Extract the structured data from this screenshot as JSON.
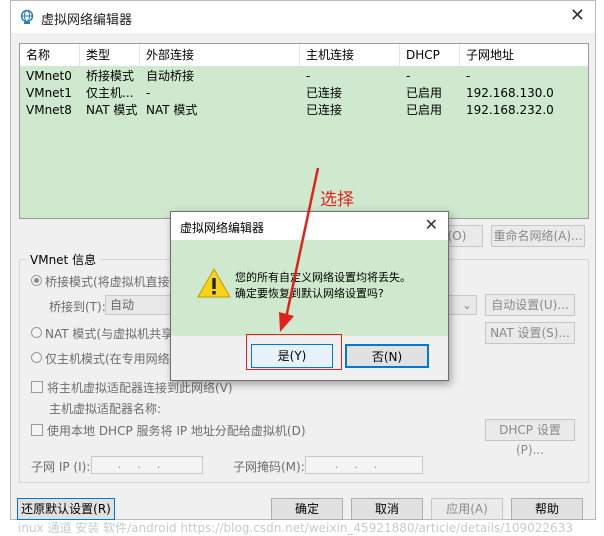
{
  "window": {
    "title": "虚拟网络编辑器",
    "close": "✕"
  },
  "table": {
    "columns": [
      "名称",
      "类型",
      "外部连接",
      "主机连接",
      "DHCP",
      "子网地址"
    ],
    "rows": [
      [
        "VMnet0",
        "桥接模式",
        "自动桥接",
        "-",
        "-",
        "-"
      ],
      [
        "VMnet1",
        "仅主机...",
        "-",
        "已连接",
        "已启用",
        "192.168.130.0"
      ],
      [
        "VMnet8",
        "NAT 模式",
        "NAT 模式",
        "已连接",
        "已启用",
        "192.168.232.0"
      ]
    ]
  },
  "network_buttons": {
    "remove": "(O)",
    "rename": "重命名网络(A)..."
  },
  "vmnet_info": {
    "label": "VMnet 信息",
    "bridged_option": "桥接模式(将虚拟机直接",
    "bridged_to_label": "桥接到(T):",
    "bridged_to_value": "自动",
    "auto_settings": "自动设置(U)...",
    "nat_option": "NAT 模式(与虚拟机共享",
    "nat_settings": "NAT 设置(S)...",
    "host_only_option": "仅主机模式(在专用网络",
    "connect_adapter": "将主机虚拟适配器连接到此网络(V)",
    "adapter_name": "主机虚拟适配器名称:",
    "use_dhcp": "使用本地 DHCP 服务将 IP 地址分配给虚拟机(D)",
    "dhcp_settings": "DHCP 设置(P)...",
    "subnet_ip_label": "子网 IP (I):",
    "subnet_mask_label": "子网掩码(M):",
    "ip_dots": "...",
    "mask_dots": "..."
  },
  "footer": {
    "restore": "还原默认设置(R)",
    "ok": "确定",
    "cancel": "取消",
    "apply": "应用(A)",
    "help": "帮助"
  },
  "message_box": {
    "title": "虚拟网络编辑器",
    "close": "✕",
    "line1": "您的所有自定义网络设置均将丢失。",
    "line2": "确定要恢复到默认网络设置吗?",
    "yes": "是(Y)",
    "no": "否(N)"
  },
  "annotation": {
    "text": "选择",
    "color": "#e2211c"
  },
  "watermark": "inux 通道 安装 软件/android https://blog.csdn.net/weixin_45921880/article/details/109022633"
}
